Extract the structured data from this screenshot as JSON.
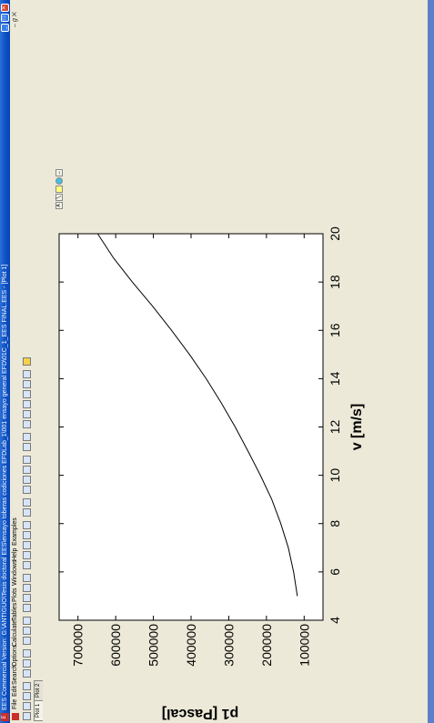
{
  "window": {
    "title": "EES Commercial Version: G:\\ANTIGUO\\Tesis doctoral EES\\ensayo toberas codiciones EFDLab_1\\001 ensayo general EFD\\01C_1_EES FINAL.EES - [Plot 1]"
  },
  "menu": {
    "items": [
      "File",
      "Edit",
      "Search",
      "Options",
      "Calculate",
      "Tables",
      "Plots",
      "Windows",
      "Help",
      "Examples"
    ],
    "mdi_controls": "– 𝑔 ✕"
  },
  "tabs": [
    {
      "label": "Plot 1",
      "active": true
    },
    {
      "label": "Plot 2",
      "active": false
    }
  ],
  "colors": {
    "titlebar": "#0a4fc4",
    "background": "#ece9d8",
    "plot_background": "#ffffff",
    "curve": "#000000"
  },
  "chart_data": {
    "type": "line",
    "xlabel": "v  [m/s]",
    "ylabel": "p1  [Pascal]",
    "xlim": [
      4,
      20
    ],
    "ylim": [
      50000,
      750000
    ],
    "xticks": [
      4,
      6,
      8,
      10,
      12,
      14,
      16,
      18,
      20
    ],
    "yticks": [
      100000,
      200000,
      300000,
      400000,
      500000,
      600000,
      700000
    ],
    "grid": false,
    "series": [
      {
        "x": [
          5,
          6,
          7,
          8,
          9,
          10,
          11,
          12,
          13,
          14,
          15,
          16,
          17,
          18,
          19,
          20
        ],
        "y": [
          118000,
          128000,
          142000,
          162000,
          186000,
          216000,
          249000,
          283000,
          320000,
          360000,
          404000,
          452000,
          502000,
          556000,
          606000,
          648000
        ]
      }
    ]
  }
}
